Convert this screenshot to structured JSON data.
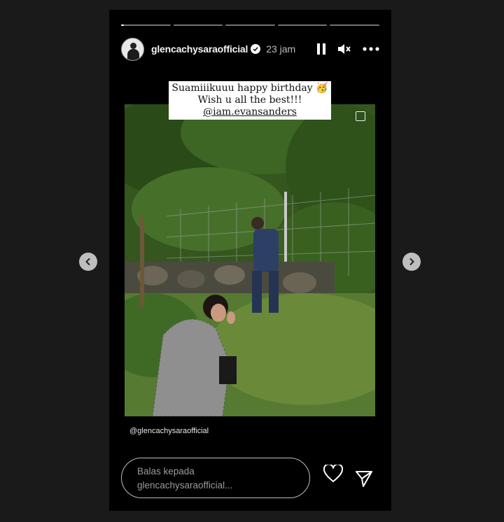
{
  "story": {
    "progress_segments": [
      0.05,
      0,
      0,
      0,
      0
    ],
    "username": "glencachysaraofficial",
    "verified": true,
    "time": "23 jam",
    "controls": [
      "pause-icon",
      "muted-speaker-icon",
      "more-icon"
    ],
    "caption": {
      "line1": "Suamiiikuuu happy birthday 🥳",
      "line2": "Wish u all the best!!!",
      "mention": "@iam.evansanders"
    },
    "credit": "@glencachysaraofficial",
    "reply": {
      "line1": "Balas kepada",
      "line2": "glencachysaraofficial..."
    }
  },
  "nav": {
    "prev_icon": "chevron-left-icon",
    "next_icon": "chevron-right-icon"
  },
  "colors": {
    "page_bg": "#1a1a1a",
    "story_bg": "#000000",
    "text": "#f5f5f5",
    "muted": "#9a9a9a"
  }
}
